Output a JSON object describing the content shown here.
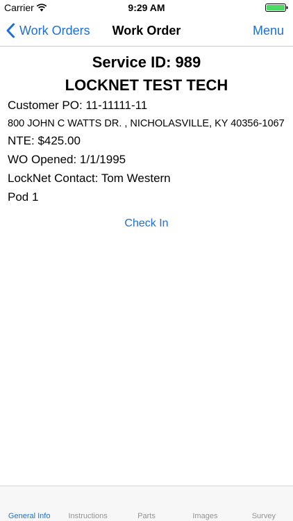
{
  "status_bar": {
    "carrier": "Carrier",
    "time": "9:29 AM",
    "icons": [
      "wifi-icon",
      "battery-icon"
    ],
    "battery_color": "#4cd964"
  },
  "nav": {
    "back_label": "Work Orders",
    "title": "Work Order",
    "menu_label": "Menu",
    "accent_color": "#1b6fd6"
  },
  "work_order": {
    "service_id": "Service ID: 989",
    "company": "LOCKNET TEST TECH",
    "customer_po": "Customer PO: 11-11111-11",
    "address": "800 JOHN C WATTS DR. , NICHOLASVILLE, KY 40356-1067",
    "nte": "NTE: $425.00",
    "wo_opened": "WO Opened: 1/1/1995",
    "contact": "LockNet Contact: Tom Western",
    "pod": "Pod 1",
    "check_in_label": "Check In"
  },
  "tabs": [
    {
      "label": "General Info",
      "active": true
    },
    {
      "label": "Instructions",
      "active": false
    },
    {
      "label": "Parts",
      "active": false
    },
    {
      "label": "Images",
      "active": false
    },
    {
      "label": "Survey",
      "active": false
    }
  ]
}
